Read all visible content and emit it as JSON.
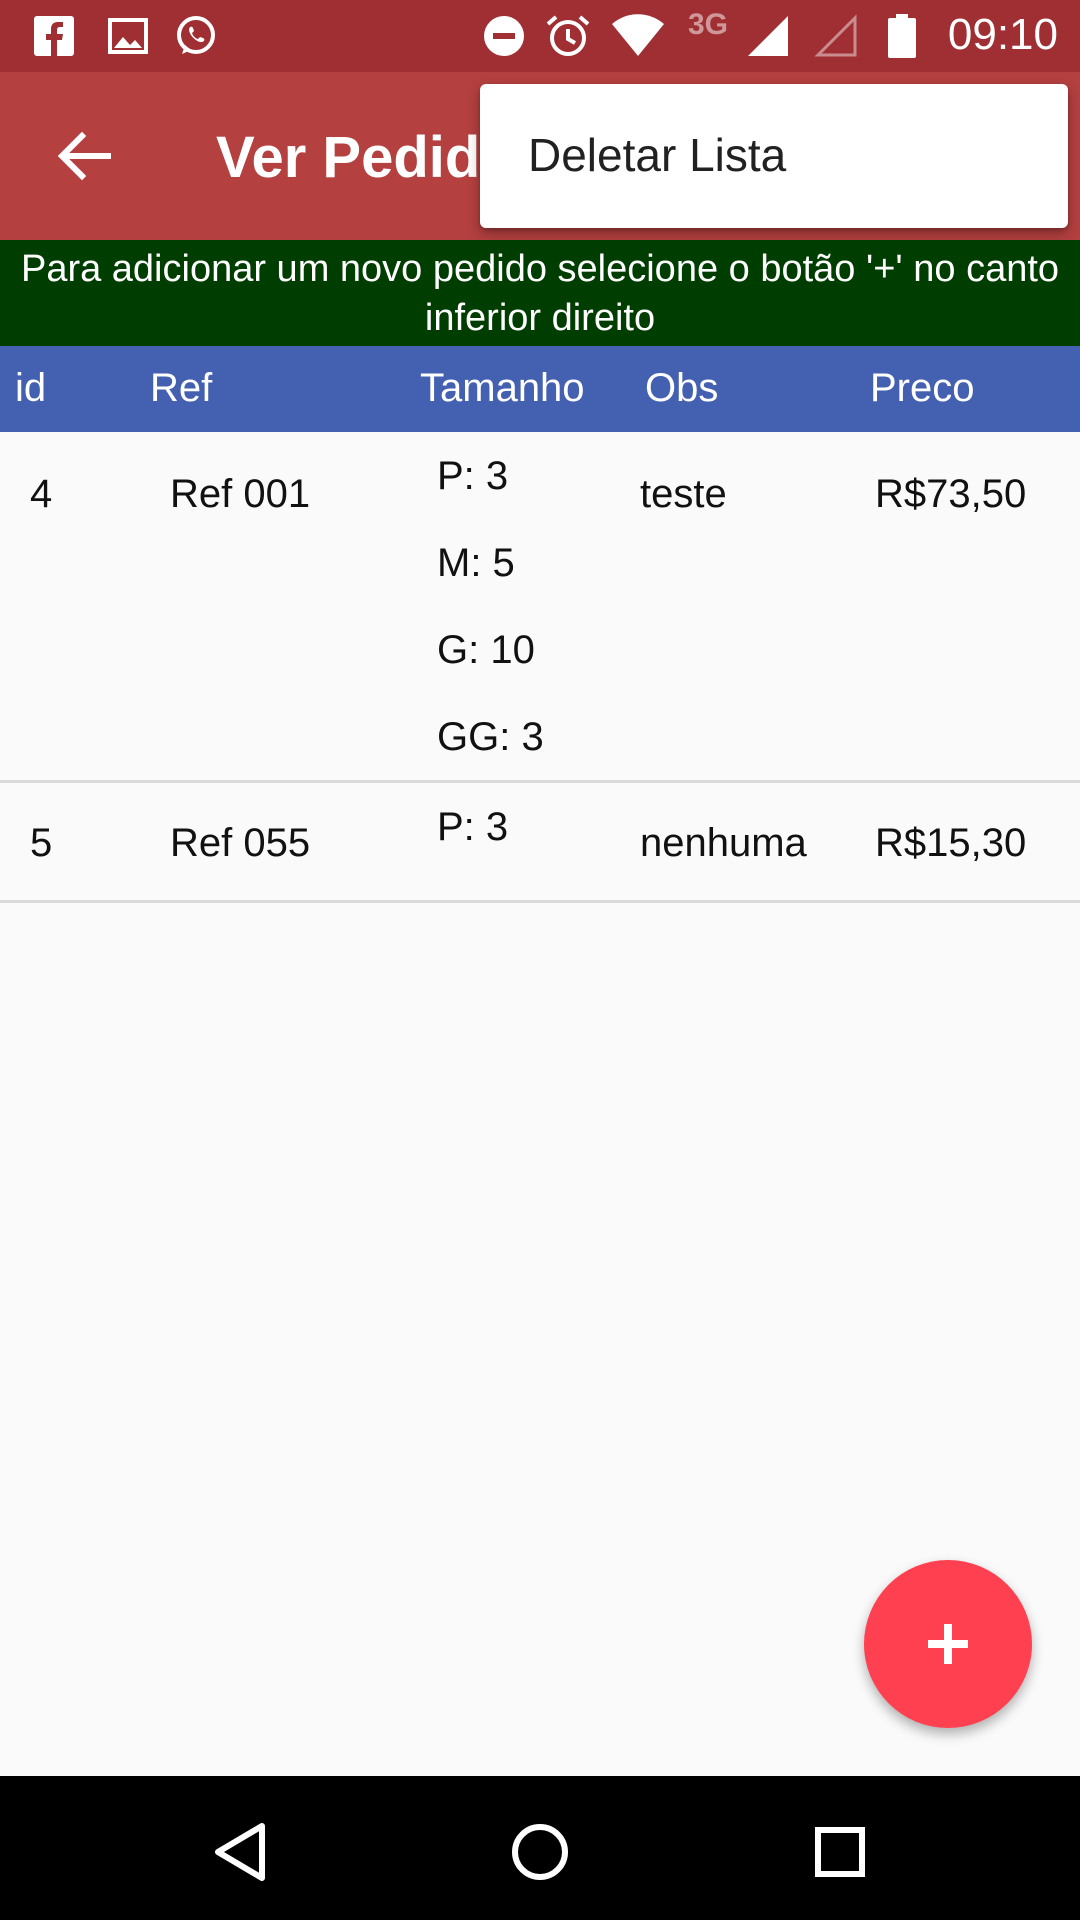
{
  "status_bar": {
    "time": "09:10",
    "network": "3G",
    "left_icons": [
      "facebook-icon",
      "gallery-icon",
      "whatsapp-icon"
    ],
    "right_icons": [
      "do-not-disturb-icon",
      "alarm-icon",
      "wifi-icon",
      "signal-icon",
      "signal-empty-icon",
      "battery-icon"
    ]
  },
  "toolbar": {
    "title": "Ver Pedidos",
    "back_icon": "arrow-back-icon"
  },
  "menu": {
    "items": [
      {
        "label": "Deletar Lista"
      }
    ]
  },
  "banner": {
    "text": "Para adicionar um novo pedido selecione o botão '+' no canto inferior direito"
  },
  "table": {
    "headers": [
      "id",
      "Ref",
      "Tamanho",
      "Obs",
      "Preco"
    ],
    "rows": [
      {
        "id": "4",
        "ref": "Ref 001",
        "sizes": [
          "P: 3",
          "M: 5",
          "G: 10",
          "GG: 3"
        ],
        "obs": "teste",
        "price": "R$73,50"
      },
      {
        "id": "5",
        "ref": "Ref 055",
        "sizes": [
          "P: 3"
        ],
        "obs": "nenhuma",
        "price": "R$15,30"
      }
    ]
  },
  "fab": {
    "icon": "plus-icon"
  },
  "nav_bar": {
    "icons": [
      "back-triangle-icon",
      "home-circle-icon",
      "recents-square-icon"
    ]
  },
  "colors": {
    "status_bar": "#9f2f33",
    "toolbar": "#b54040",
    "banner": "#003d00",
    "table_header": "#4460b0",
    "fab": "#ff4050"
  }
}
